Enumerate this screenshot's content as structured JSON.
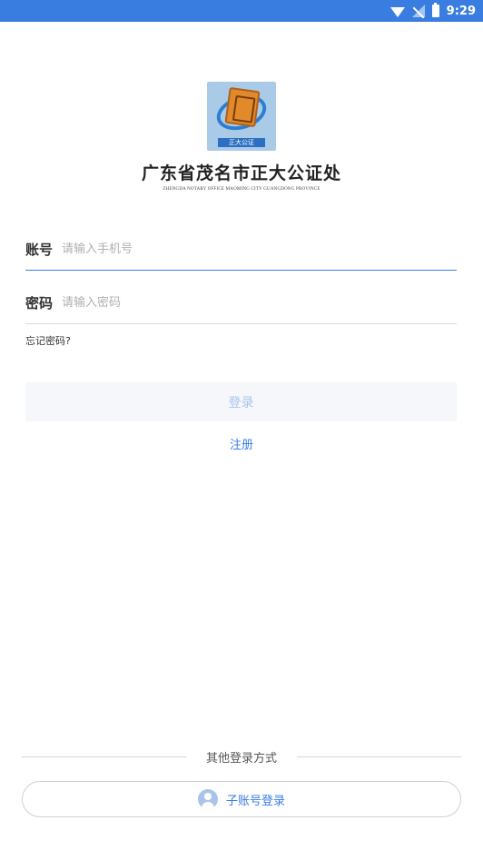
{
  "status_bar": {
    "time": "9:29",
    "icons": [
      "wifi-icon",
      "no-signal-icon",
      "battery-icon"
    ]
  },
  "org": {
    "logo_banner": "正大公证",
    "name": "广东省茂名市正大公证处",
    "subtitle": "ZHENGDA NOTARY OFFICE MAOMING CITY GUANGDONG PROVINCE"
  },
  "form": {
    "account_label": "账号",
    "account_placeholder": "请输入手机号",
    "account_value": "",
    "password_label": "密码",
    "password_placeholder": "请输入密码",
    "password_value": "",
    "forgot_label": "忘记密码?",
    "login_label": "登录",
    "register_label": "注册"
  },
  "other_login": {
    "divider_label": "其他登录方式",
    "sub_account_label": "子账号登录"
  },
  "colors": {
    "accent": "#3a7de0",
    "button_bg": "#f5f7fb",
    "button_text": "#a9c4ea"
  }
}
